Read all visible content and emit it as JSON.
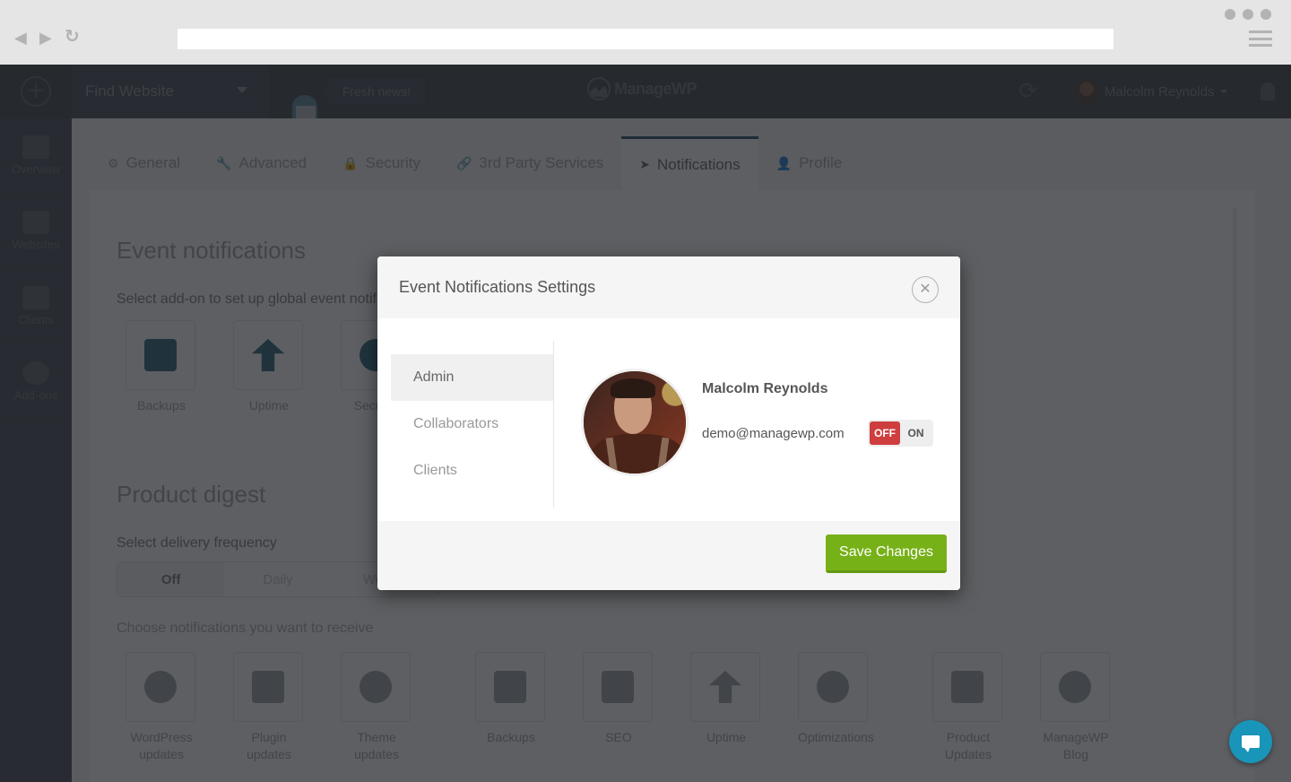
{
  "browser": {
    "url": "",
    "back_icon": "back-arrow-icon",
    "forward_icon": "forward-arrow-icon",
    "reload_icon": "reload-icon",
    "menu_icon": "hamburger-icon"
  },
  "topbar": {
    "add_icon": "plus-circle-icon",
    "find_website": "Find Website",
    "fresh_news": "Fresh news!",
    "logo_text": "ManageWP",
    "sync_icon": "sync-icon",
    "user_name": "Malcolm Reynolds",
    "bell_icon": "bell-icon"
  },
  "sidebar": {
    "items": [
      {
        "label": "Overview",
        "icon": "monitor-chart-icon"
      },
      {
        "label": "Websites",
        "icon": "websites-list-icon"
      },
      {
        "label": "Clients",
        "icon": "id-badge-icon"
      },
      {
        "label": "Add-ons",
        "icon": "star-badge-icon"
      }
    ]
  },
  "tabs": [
    {
      "label": "General",
      "icon": "gear-icon",
      "active": false
    },
    {
      "label": "Advanced",
      "icon": "wrench-icon",
      "active": false
    },
    {
      "label": "Security",
      "icon": "lock-icon",
      "active": false
    },
    {
      "label": "3rd Party Services",
      "icon": "link-icon",
      "active": false
    },
    {
      "label": "Notifications",
      "icon": "paper-plane-icon",
      "active": true
    },
    {
      "label": "Profile",
      "icon": "user-icon",
      "active": false
    }
  ],
  "event_notifications": {
    "title": "Event notifications",
    "subtitle": "Select add-on to set up global event notifications",
    "addons": [
      {
        "label": "Backups",
        "icon": "backup-drive-icon"
      },
      {
        "label": "Uptime",
        "icon": "uptime-arrow-icon"
      },
      {
        "label": "Security",
        "icon": "shield-icon"
      }
    ]
  },
  "product_digest": {
    "title": "Product digest",
    "frequency_label": "Select delivery frequency",
    "frequency_options": [
      "Off",
      "Daily",
      "Weekly"
    ],
    "selected_frequency": "Off",
    "choose_label": "Choose notifications you want to receive",
    "notifications": [
      {
        "label": "WordPress updates",
        "icon": "wordpress-icon"
      },
      {
        "label": "Plugin updates",
        "icon": "plug-icon"
      },
      {
        "label": "Theme updates",
        "icon": "palette-icon"
      },
      {
        "label": "Backups",
        "icon": "backup-drive-icon"
      },
      {
        "label": "SEO",
        "icon": "megaphone-icon"
      },
      {
        "label": "Uptime",
        "icon": "uptime-arrow-icon"
      },
      {
        "label": "Optimizations",
        "icon": "gauge-icon"
      },
      {
        "label": "Product Updates",
        "icon": "list-icon"
      },
      {
        "label": "ManageWP Blog",
        "icon": "managewp-logo-icon"
      }
    ]
  },
  "modal": {
    "title": "Event Notifications Settings",
    "close_icon": "close-circle-icon",
    "nav": [
      {
        "label": "Admin",
        "active": true
      },
      {
        "label": "Collaborators",
        "active": false
      },
      {
        "label": "Clients",
        "active": false
      }
    ],
    "user": {
      "name": "Malcolm Reynolds",
      "email": "demo@managewp.com",
      "toggle_off": "OFF",
      "toggle_on": "ON",
      "toggle_state": "OFF"
    },
    "save_label": "Save Changes"
  },
  "colors": {
    "save_green": "#77b118",
    "toggle_off_red": "#cf3e3e",
    "chat_blue": "#1895b8",
    "accent_tab": "#1f4a64"
  },
  "chat": {
    "icon": "chat-bubble-icon"
  }
}
